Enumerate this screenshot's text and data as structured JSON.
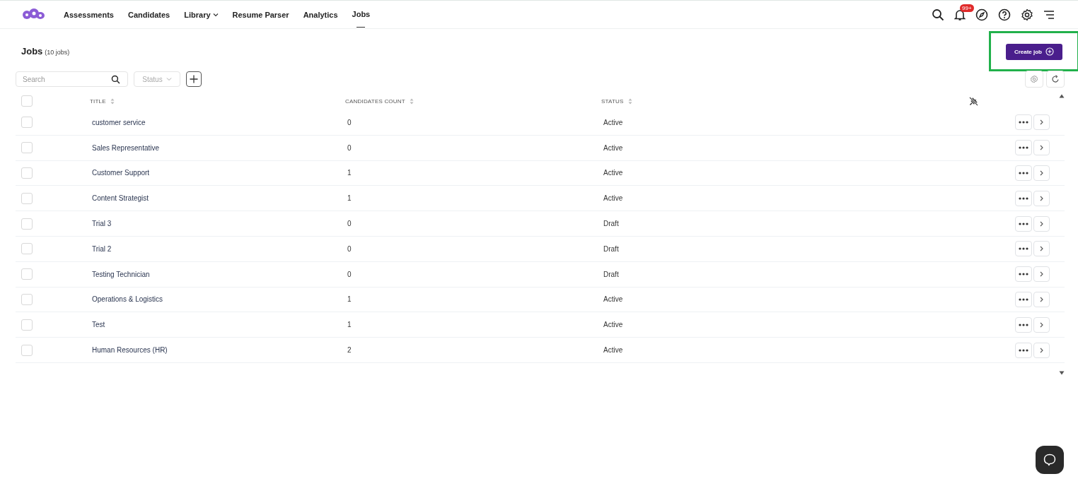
{
  "nav": {
    "items": [
      {
        "label": "Assessments",
        "selected": false,
        "dropdown": false
      },
      {
        "label": "Candidates",
        "selected": false,
        "dropdown": false
      },
      {
        "label": "Library",
        "selected": false,
        "dropdown": true
      },
      {
        "label": "Resume Parser",
        "selected": false,
        "dropdown": false
      },
      {
        "label": "Analytics",
        "selected": false,
        "dropdown": false
      },
      {
        "label": "Jobs",
        "selected": true,
        "dropdown": false
      }
    ],
    "notification_badge": "99+"
  },
  "page": {
    "title": "Jobs",
    "count": "(10 jobs)",
    "create_button": "Create job",
    "highlighted": true
  },
  "filters": {
    "search_placeholder": "Search",
    "status_placeholder": "Status"
  },
  "table": {
    "header_checked": false,
    "columns": [
      "TITLE",
      "CANDIDATES COUNT",
      "STATUS"
    ],
    "rows": [
      {
        "title": "customer service",
        "count": "0",
        "status": "Active",
        "checked": false
      },
      {
        "title": "Sales Representative",
        "count": "0",
        "status": "Active",
        "checked": false
      },
      {
        "title": "Customer Support",
        "count": "1",
        "status": "Active",
        "checked": false
      },
      {
        "title": "Content Strategist",
        "count": "1",
        "status": "Active",
        "checked": false
      },
      {
        "title": "Trial 3",
        "count": "0",
        "status": "Draft",
        "checked": false
      },
      {
        "title": "Trial 2",
        "count": "0",
        "status": "Draft",
        "checked": false
      },
      {
        "title": "Testing Technician",
        "count": "0",
        "status": "Draft",
        "checked": false
      },
      {
        "title": "Operations & Logistics",
        "count": "1",
        "status": "Active",
        "checked": false
      },
      {
        "title": "Test",
        "count": "1",
        "status": "Active",
        "checked": false
      },
      {
        "title": "Human Resources (HR)",
        "count": "2",
        "status": "Active",
        "checked": false
      }
    ]
  }
}
